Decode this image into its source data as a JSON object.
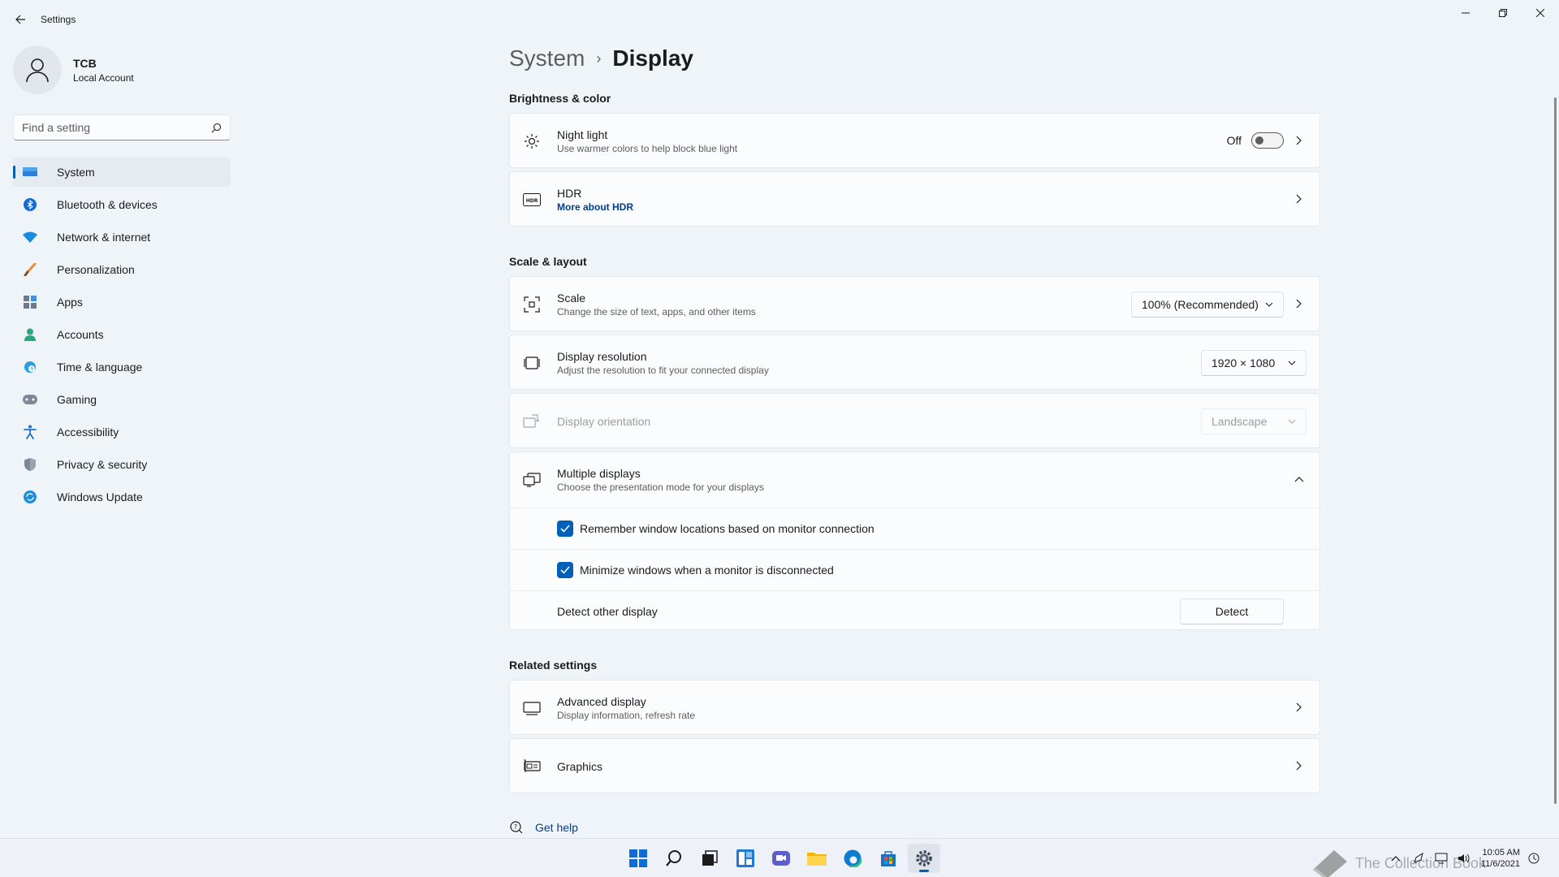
{
  "window": {
    "title": "Settings"
  },
  "profile": {
    "name": "TCB",
    "account_type": "Local Account"
  },
  "search": {
    "placeholder": "Find a setting"
  },
  "sidebar": {
    "items": [
      {
        "label": "System",
        "icon": "monitor-icon",
        "active": true
      },
      {
        "label": "Bluetooth & devices",
        "icon": "bluetooth-icon"
      },
      {
        "label": "Network & internet",
        "icon": "wifi-icon"
      },
      {
        "label": "Personalization",
        "icon": "brush-icon"
      },
      {
        "label": "Apps",
        "icon": "apps-icon"
      },
      {
        "label": "Accounts",
        "icon": "person-icon"
      },
      {
        "label": "Time & language",
        "icon": "globe-clock-icon"
      },
      {
        "label": "Gaming",
        "icon": "gamepad-icon"
      },
      {
        "label": "Accessibility",
        "icon": "accessibility-icon"
      },
      {
        "label": "Privacy & security",
        "icon": "shield-icon"
      },
      {
        "label": "Windows Update",
        "icon": "update-icon"
      }
    ]
  },
  "breadcrumb": {
    "parent": "System",
    "current": "Display"
  },
  "brightness": {
    "heading": "Brightness & color",
    "night_light": {
      "title": "Night light",
      "subtitle": "Use warmer colors to help block blue light",
      "state": "Off"
    },
    "hdr": {
      "title": "HDR",
      "link": "More about HDR"
    }
  },
  "scale_layout": {
    "heading": "Scale & layout",
    "scale": {
      "title": "Scale",
      "subtitle": "Change the size of text, apps, and other items",
      "value": "100% (Recommended)"
    },
    "resolution": {
      "title": "Display resolution",
      "subtitle": "Adjust the resolution to fit your connected display",
      "value": "1920 × 1080"
    },
    "orientation": {
      "title": "Display orientation",
      "value": "Landscape"
    },
    "multiple": {
      "title": "Multiple displays",
      "subtitle": "Choose the presentation mode for your displays",
      "remember": "Remember window locations based on monitor connection",
      "minimize": "Minimize windows when a monitor is disconnected",
      "detect_label": "Detect other display",
      "detect_button": "Detect"
    }
  },
  "related": {
    "heading": "Related settings",
    "advanced": {
      "title": "Advanced display",
      "subtitle": "Display information, refresh rate"
    },
    "graphics": {
      "title": "Graphics"
    }
  },
  "help": {
    "label": "Get help"
  },
  "taskbar": {
    "clock_time": "10:05 AM",
    "clock_date": "11/6/2021",
    "watermark": "The Collection Book"
  },
  "colors": {
    "accent": "#005fb8",
    "background": "#eff4f9",
    "card": "#fbfcfd"
  }
}
